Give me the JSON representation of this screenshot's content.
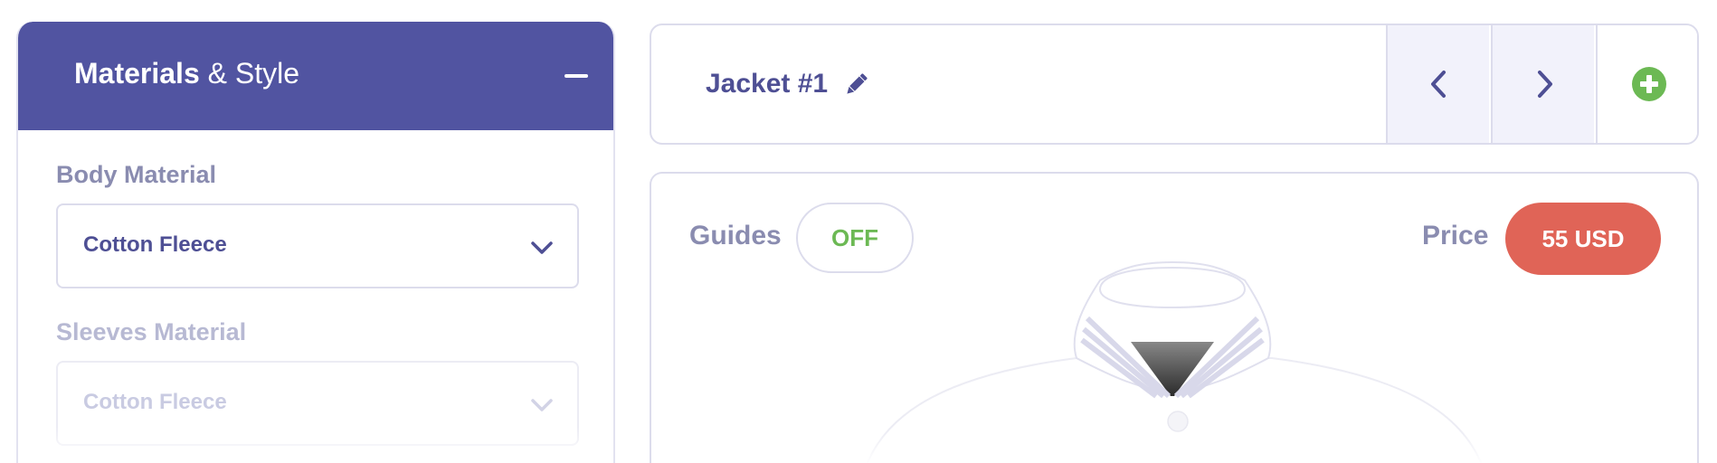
{
  "materials_panel": {
    "title_bold": "Materials",
    "title_rest": " & Style",
    "collapse_icon": "minus-icon",
    "fields": [
      {
        "label": "Body Material",
        "value": "Cotton Fleece",
        "enabled": true,
        "icon": "chevron-down-icon"
      },
      {
        "label": "Sleeves Material",
        "value": "Cotton Fleece",
        "enabled": false,
        "icon": "chevron-down-icon"
      }
    ]
  },
  "top_bar": {
    "jacket_name": "Jacket #1",
    "edit_icon": "pencil-icon",
    "prev_icon": "chevron-left-icon",
    "next_icon": "chevron-right-icon",
    "add_icon": "plus-circle-icon"
  },
  "preview": {
    "guides_label": "Guides",
    "guides_toggle": "OFF",
    "price_label": "Price",
    "price_value": "55 USD"
  },
  "colors": {
    "header_bg": "#5154a1",
    "accent_text": "#4e4f94",
    "label_text": "#8a8cb0",
    "toggle_green": "#6cb954",
    "price_red": "#e06457",
    "nav_bg": "#f2f2fb"
  }
}
